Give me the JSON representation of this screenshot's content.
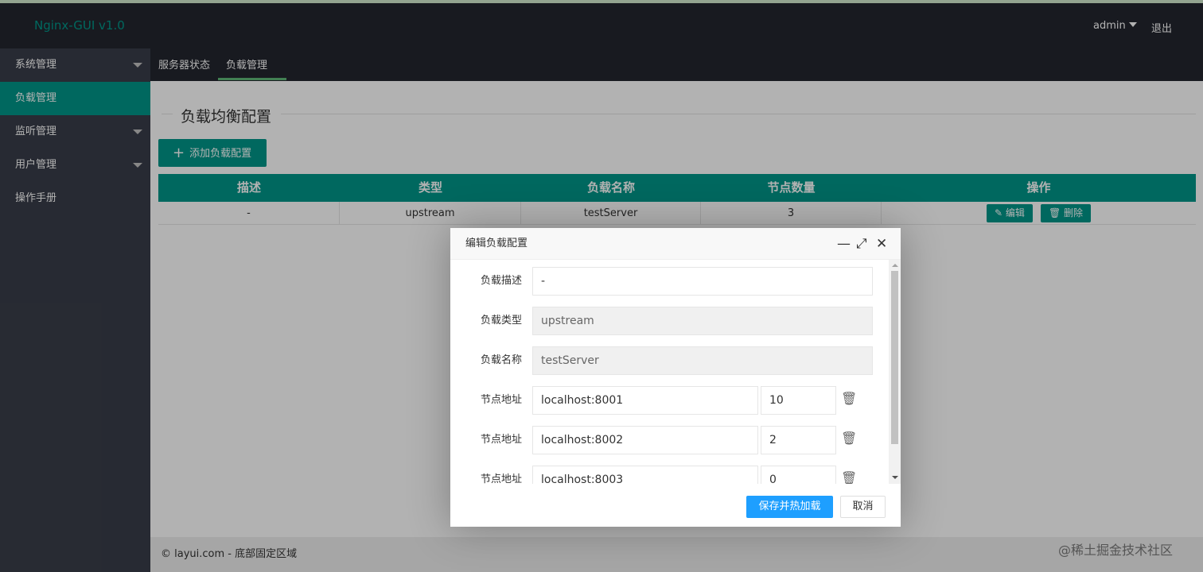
{
  "header": {
    "logo": "Nginx-GUI v1.0",
    "user": "admin",
    "logout": "退出"
  },
  "sidebar": {
    "items": [
      {
        "label": "系统管理"
      },
      {
        "label": "负载管理"
      },
      {
        "label": "监听管理"
      },
      {
        "label": "用户管理"
      },
      {
        "label": "操作手册"
      }
    ]
  },
  "tabs": [
    {
      "label": "服务器状态"
    },
    {
      "label": "负载管理"
    }
  ],
  "page": {
    "title": "负载均衡配置",
    "add_button": "添加负载配置",
    "table": {
      "headers": [
        "描述",
        "类型",
        "负载名称",
        "节点数量",
        "操作"
      ],
      "rows": [
        {
          "desc": "-",
          "type": "upstream",
          "name": "testServer",
          "count": "3"
        }
      ],
      "edit_label": "编辑",
      "delete_label": "删除"
    }
  },
  "footer": {
    "text": "© layui.com - 底部固定区域"
  },
  "modal": {
    "title": "编辑负载配置",
    "fields": {
      "desc_label": "负载描述",
      "desc_value": "-",
      "type_label": "负载类型",
      "type_value": "upstream",
      "name_label": "负载名称",
      "name_value": "testServer"
    },
    "nodes": [
      {
        "label": "节点地址",
        "address": "localhost:8001",
        "weight": "10"
      },
      {
        "label": "节点地址",
        "address": "localhost:8002",
        "weight": "2"
      },
      {
        "label": "节点地址",
        "address": "localhost:8003",
        "weight": "0"
      }
    ],
    "save_button": "保存并热加载",
    "cancel_button": "取消"
  },
  "watermark": "@稀土掘金技术社区",
  "colors": {
    "accent": "#009688",
    "primary_button": "#1e9fff",
    "dark": "#23262e",
    "sidebar": "#393d49"
  }
}
